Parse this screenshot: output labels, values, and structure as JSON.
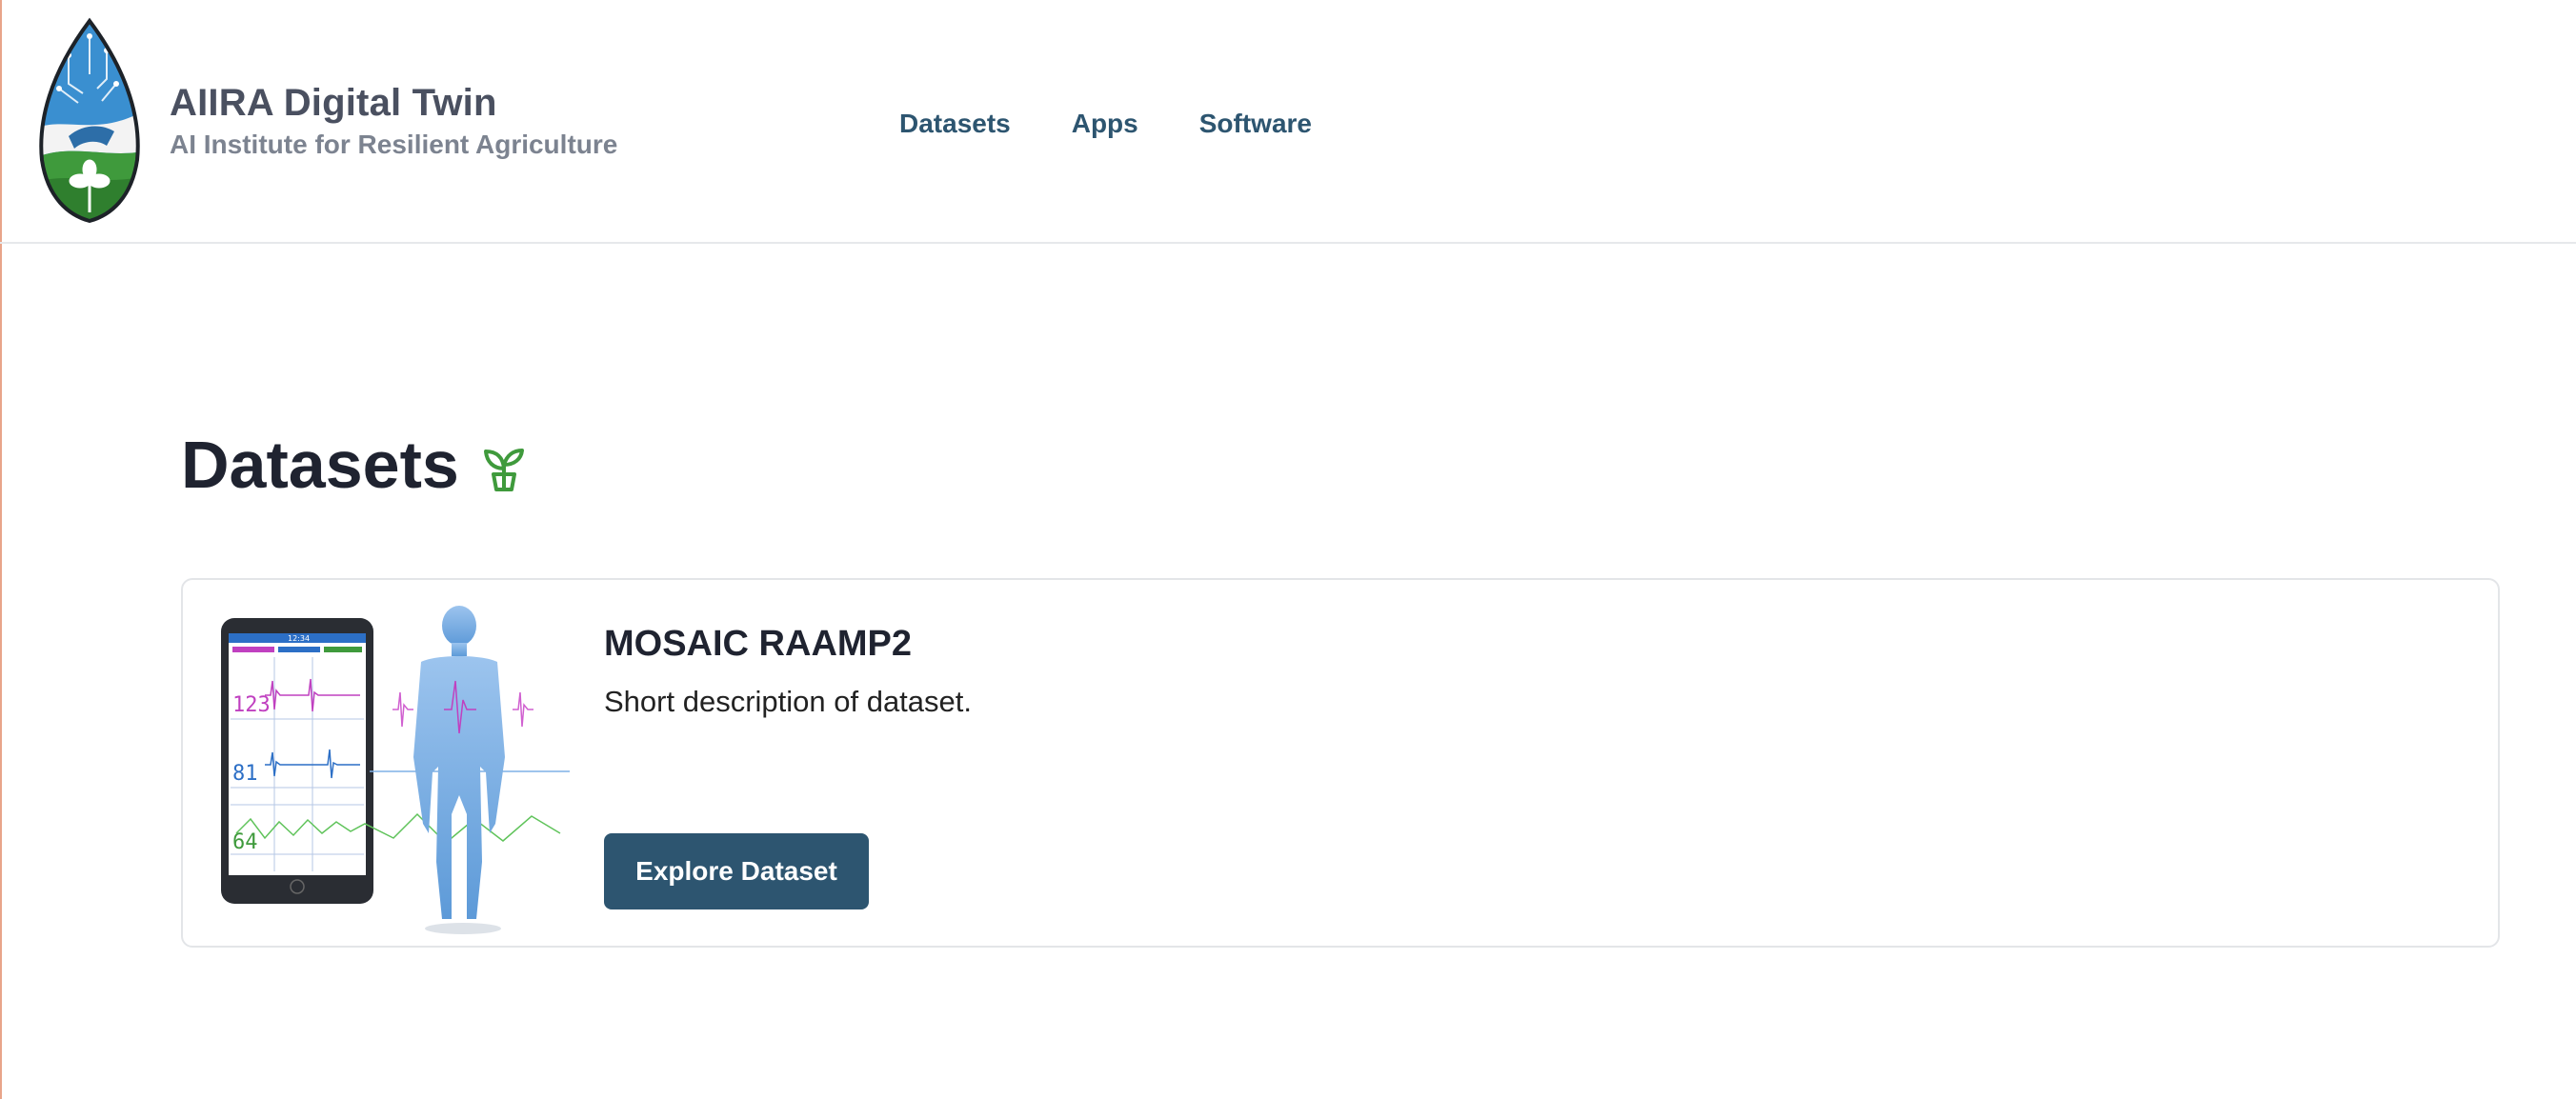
{
  "header": {
    "logo_icon": "aiira-leaf-logo",
    "title": "AIIRA Digital Twin",
    "subtitle": "AI Institute for Resilient Agriculture"
  },
  "nav": {
    "items": [
      {
        "label": "Datasets"
      },
      {
        "label": "Apps"
      },
      {
        "label": "Software"
      }
    ]
  },
  "main": {
    "title": "Datasets",
    "title_icon": "sprout-icon",
    "cards": [
      {
        "title": "MOSAIC RAAMP2",
        "description": "Short description of dataset.",
        "button_label": "Explore Dataset",
        "image": {
          "phone_time": "12:34",
          "readings": [
            "123",
            "81",
            "64"
          ]
        }
      }
    ]
  },
  "colors": {
    "nav_link": "#2d5570",
    "button_bg": "#2d5570",
    "sprout": "#3f9a3c",
    "title_text": "#1f2330",
    "subtitle_text": "#7c8390"
  }
}
